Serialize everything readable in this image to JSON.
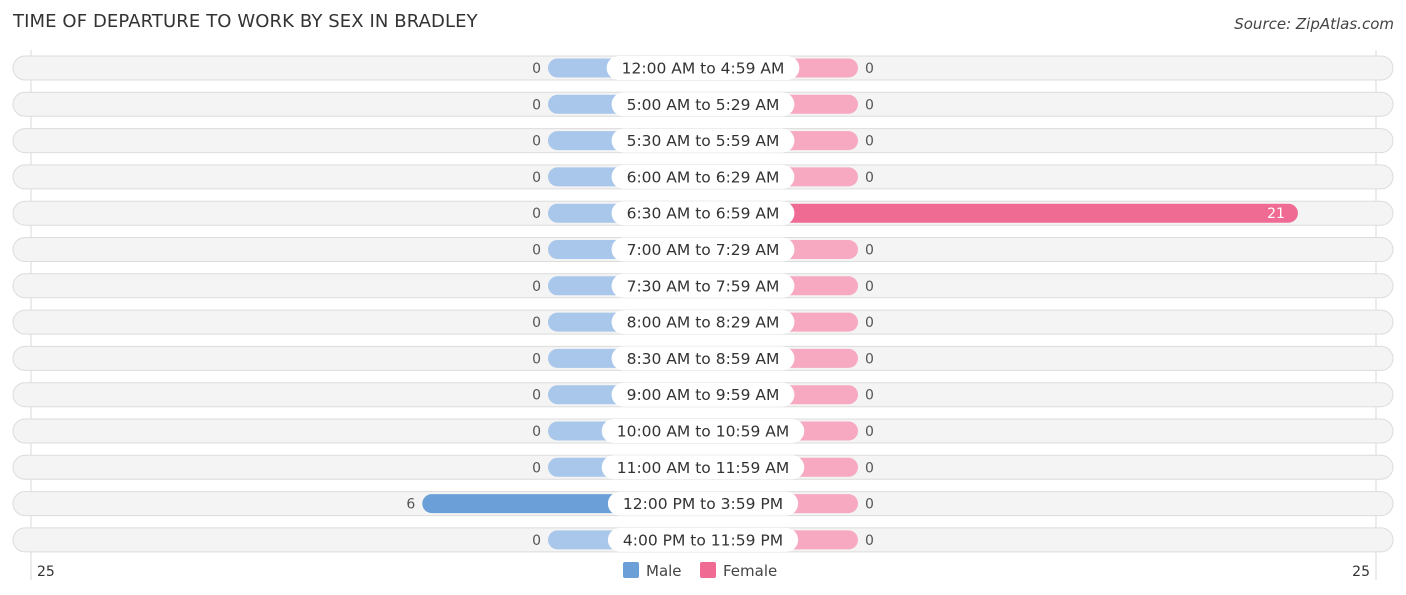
{
  "title": "TIME OF DEPARTURE TO WORK BY SEX IN BRADLEY",
  "source": "Source: ZipAtlas.com",
  "chart_data": {
    "type": "bar",
    "orientation": "horizontal-diverging",
    "title": "TIME OF DEPARTURE TO WORK BY SEX IN BRADLEY",
    "categories": [
      "12:00 AM to 4:59 AM",
      "5:00 AM to 5:29 AM",
      "5:30 AM to 5:59 AM",
      "6:00 AM to 6:29 AM",
      "6:30 AM to 6:59 AM",
      "7:00 AM to 7:29 AM",
      "7:30 AM to 7:59 AM",
      "8:00 AM to 8:29 AM",
      "8:30 AM to 8:59 AM",
      "9:00 AM to 9:59 AM",
      "10:00 AM to 10:59 AM",
      "11:00 AM to 11:59 AM",
      "12:00 PM to 3:59 PM",
      "4:00 PM to 11:59 PM"
    ],
    "series": [
      {
        "name": "Male",
        "color": "#6a9fd8",
        "light_color": "#a9c7ea",
        "values": [
          0,
          0,
          0,
          0,
          0,
          0,
          0,
          0,
          0,
          0,
          0,
          0,
          6,
          0
        ]
      },
      {
        "name": "Female",
        "color": "#f06b94",
        "light_color": "#f6a9c0",
        "values": [
          0,
          0,
          0,
          0,
          21,
          0,
          0,
          0,
          0,
          0,
          0,
          0,
          0,
          0
        ]
      }
    ],
    "axis": {
      "left_label": "25",
      "right_label": "25",
      "range": [
        0,
        25
      ]
    },
    "legend": {
      "position": "bottom-center",
      "entries": [
        "Male",
        "Female"
      ]
    },
    "grid": false
  }
}
